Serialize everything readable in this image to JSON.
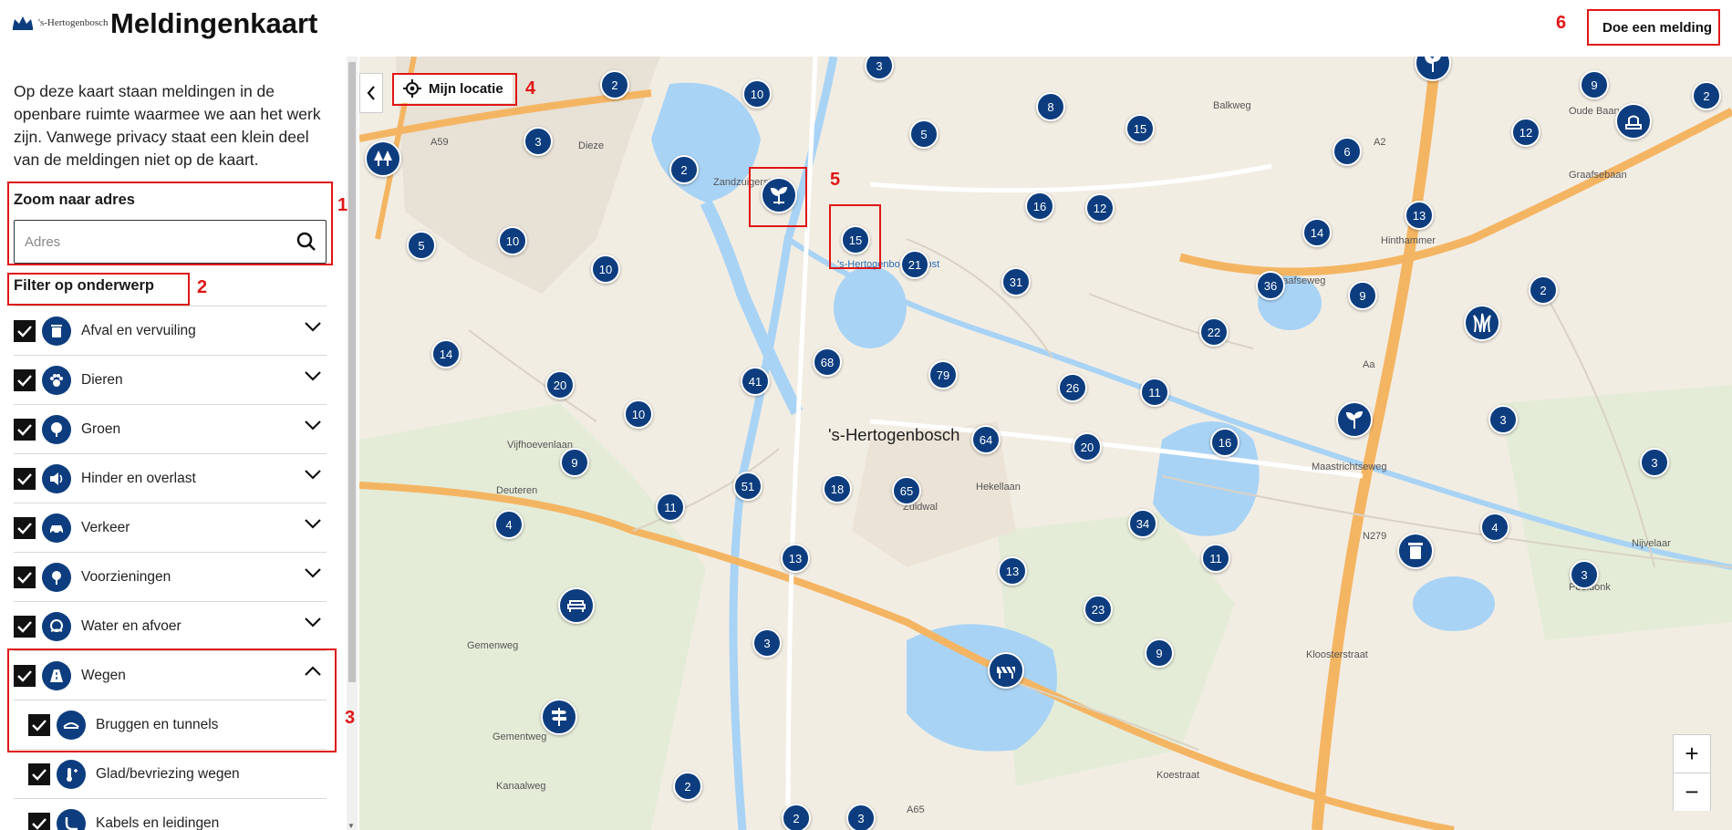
{
  "header": {
    "logo_text": "'s-Hertogenbosch",
    "title": "Meldingenkaart",
    "report_button": "Doe een melding"
  },
  "sidebar": {
    "intro": "Op deze kaart staan meldingen in de openbare ruimte waarmee we aan het werk zijn. Vanwege privacy staat een klein deel van de meldingen niet op de kaart.",
    "zoom_title": "Zoom naar adres",
    "address_placeholder": "Adres",
    "filter_title": "Filter op onderwerp",
    "filters": [
      {
        "label": "Afval en vervuiling",
        "icon": "trash-icon",
        "checked": true,
        "expanded": false
      },
      {
        "label": "Dieren",
        "icon": "paw-icon",
        "checked": true,
        "expanded": false
      },
      {
        "label": "Groen",
        "icon": "tree-icon",
        "checked": true,
        "expanded": false
      },
      {
        "label": "Hinder en overlast",
        "icon": "speaker-icon",
        "checked": true,
        "expanded": false
      },
      {
        "label": "Verkeer",
        "icon": "car-icon",
        "checked": true,
        "expanded": false
      },
      {
        "label": "Voorzieningen",
        "icon": "facility-icon",
        "checked": true,
        "expanded": false
      },
      {
        "label": "Water en afvoer",
        "icon": "water-icon",
        "checked": true,
        "expanded": false
      },
      {
        "label": "Wegen",
        "icon": "road-icon",
        "checked": true,
        "expanded": true
      }
    ],
    "subfilters": [
      {
        "label": "Bruggen en tunnels",
        "icon": "bridge-icon",
        "checked": true
      },
      {
        "label": "Glad/bevriezing wegen",
        "icon": "frost-icon",
        "checked": true
      },
      {
        "label": "Kabels en leidingen",
        "icon": "cable-icon",
        "checked": true
      }
    ]
  },
  "map": {
    "locate_button": "Mijn locatie",
    "city_label": "'s-Hertogenbosch",
    "clusters": [
      "3",
      "2",
      "10",
      "3",
      "5",
      "8",
      "15",
      "6",
      "9",
      "2",
      "12",
      "2",
      "16",
      "12",
      "13",
      "14",
      "15",
      "21",
      "10",
      "10",
      "5",
      "31",
      "36",
      "9",
      "2",
      "22",
      "14",
      "68",
      "79",
      "41",
      "20",
      "10",
      "26",
      "11",
      "3",
      "64",
      "20",
      "16",
      "9",
      "3",
      "18",
      "65",
      "51",
      "11",
      "34",
      "4",
      "4",
      "13",
      "11",
      "13",
      "3",
      "23",
      "9",
      "3",
      "2",
      "2",
      "3"
    ],
    "place_labels": [
      "Zandzuigerstraat",
      "Balkweg",
      "Oude Baan",
      "Graafsebaan",
      "Hinthammer",
      "Graafseweg",
      "Vijfhoevenlaan",
      "Hekellaan",
      "Zuidwal",
      "Maastrichtseweg",
      "Nijvelaar",
      "Poeldonk",
      "Kloosterstraat",
      "Koestraat",
      "Deuteren",
      "Gemenweg",
      "Gementweg",
      "Kanaalweg",
      "'s-Hertogenbosch Oost",
      "A59",
      "A2",
      "A65",
      "N279",
      "Aa",
      "Dieze"
    ],
    "zoom_in": "+",
    "zoom_out": "−"
  },
  "annotations": [
    "1",
    "2",
    "3",
    "4",
    "5",
    "6"
  ],
  "colors": {
    "marker": "#0d3d7e",
    "annotation": "#e01616",
    "water": "#a9d3f5",
    "land": "#f2ede3",
    "highway": "#f4b563"
  }
}
